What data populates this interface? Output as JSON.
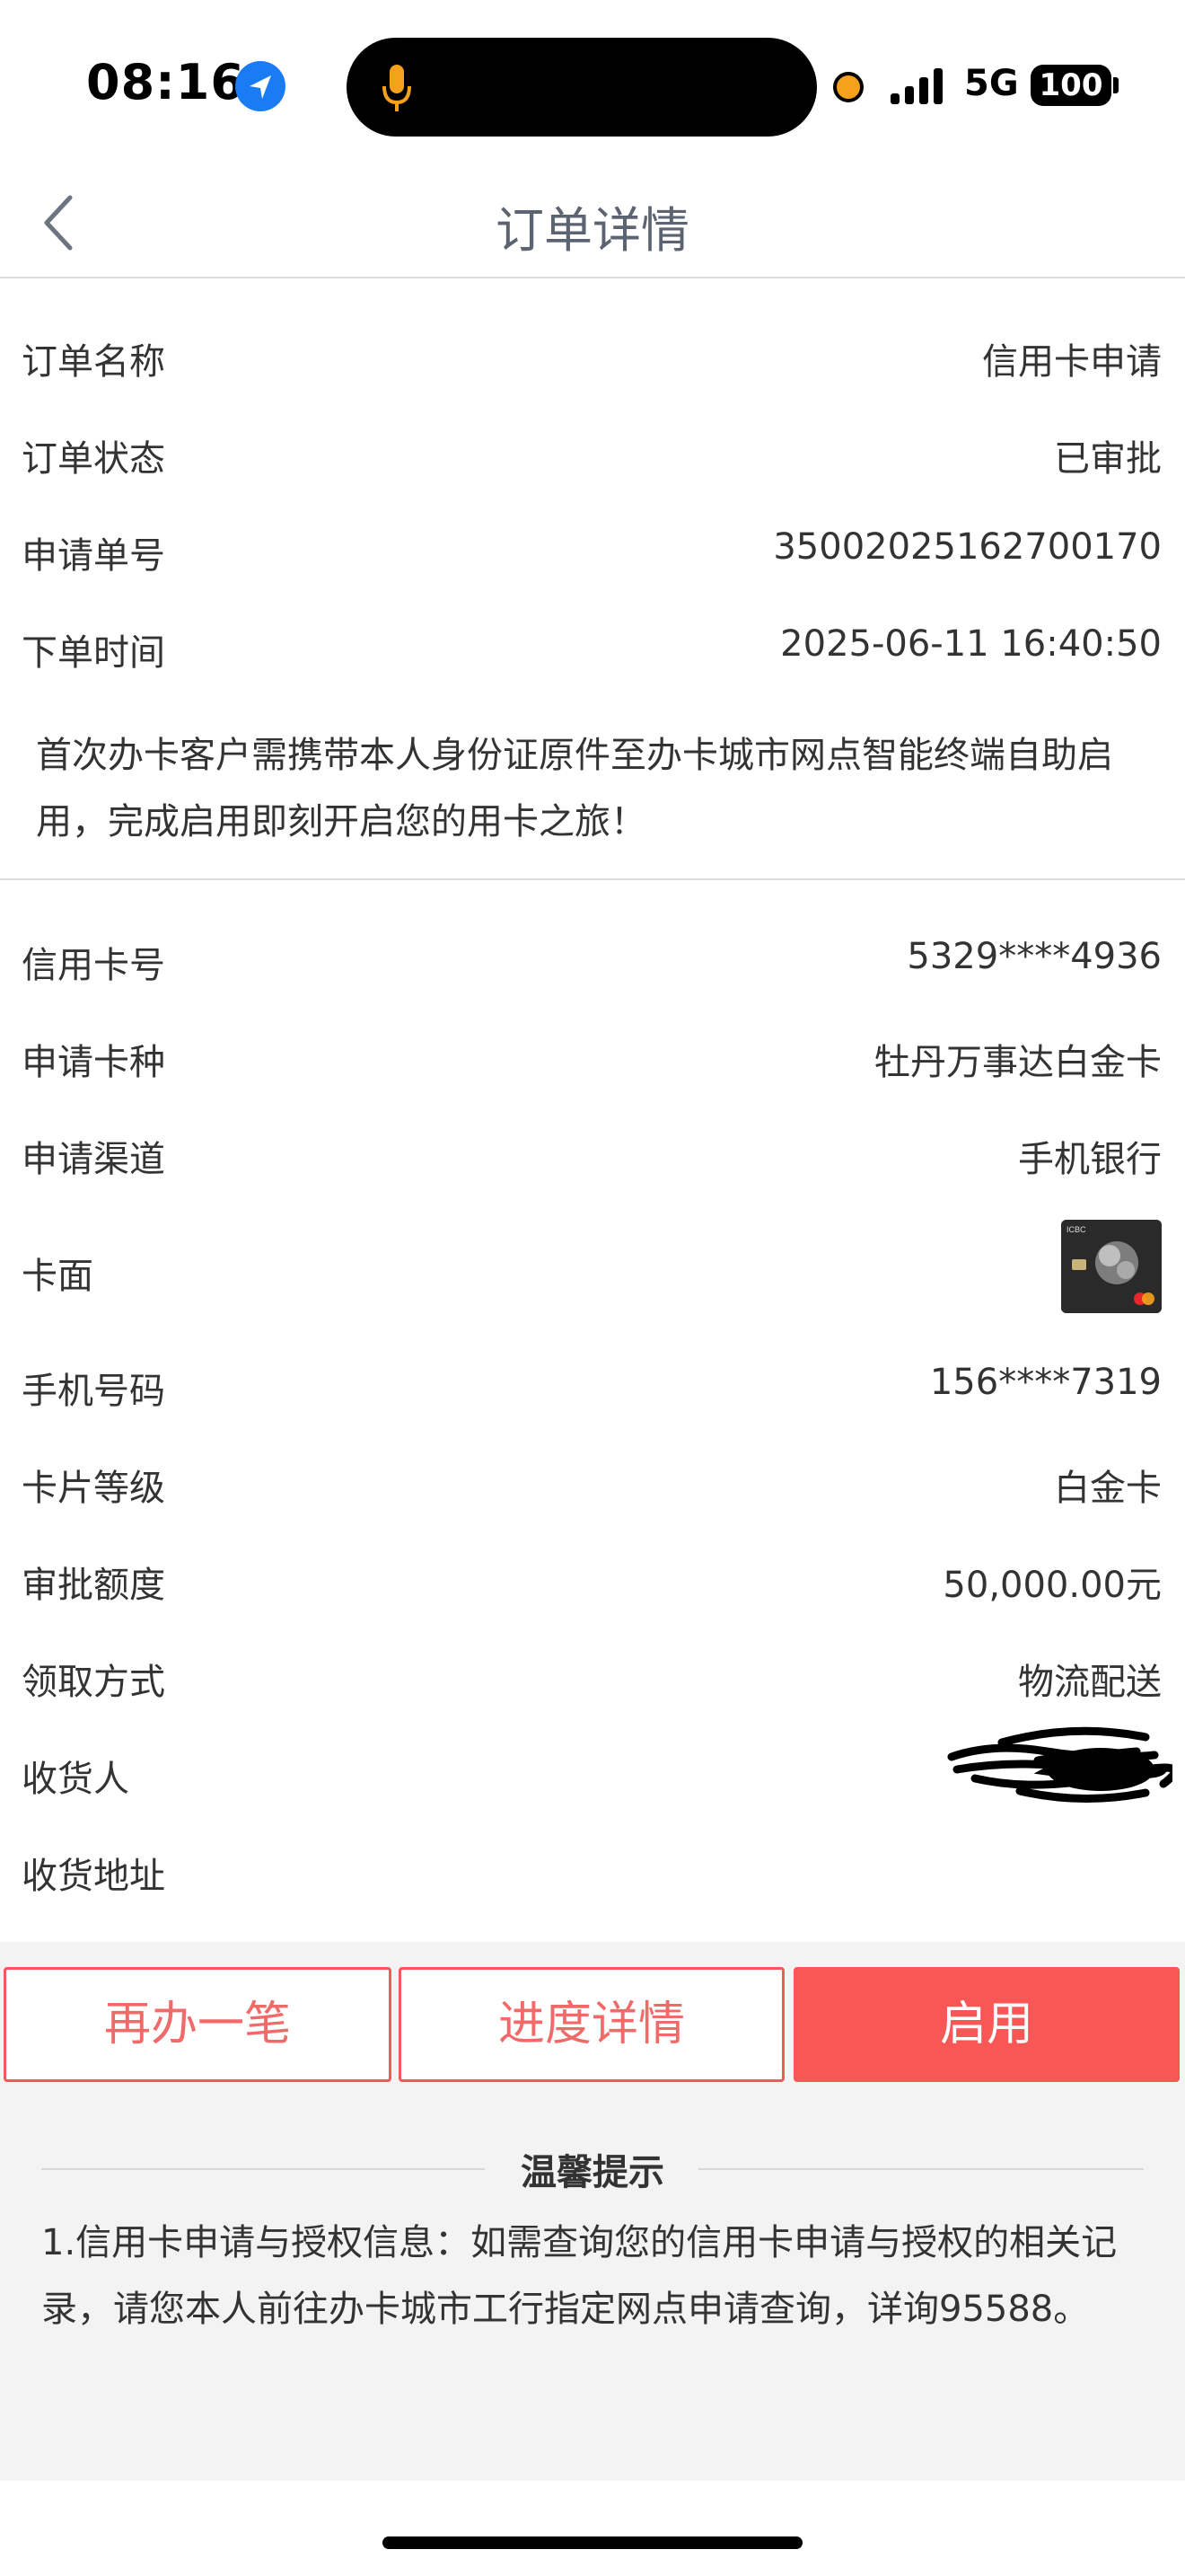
{
  "status_bar": {
    "time": "08:16",
    "network": "5G",
    "battery": "100"
  },
  "nav": {
    "title": "订单详情"
  },
  "order": {
    "rows": [
      {
        "label": "订单名称",
        "value": "信用卡申请"
      },
      {
        "label": "订单状态",
        "value": "已审批"
      },
      {
        "label": "申请单号",
        "value": "3500202516270017​0"
      },
      {
        "label": "下单时间",
        "value": "2025-06-11 16:40:50"
      }
    ],
    "notice": "首次办卡客户需携带本人身份证原件至办卡城市网点智能终端自助启用，完成启用即刻开启您的用卡之旅！"
  },
  "card": {
    "rows": [
      {
        "label": "信用卡号",
        "value": "5329****4936"
      },
      {
        "label": "申请卡种",
        "value": "牡丹万事达白金卡"
      },
      {
        "label": "申请渠道",
        "value": "手机银行"
      },
      {
        "label": "卡面",
        "value": ""
      },
      {
        "label": "手机号码",
        "value": "156****7319"
      },
      {
        "label": "卡片等级",
        "value": "白金卡"
      },
      {
        "label": "审批额度",
        "value": "50,000.00元"
      },
      {
        "label": "领取方式",
        "value": "物流配送"
      },
      {
        "label": "收货人",
        "value": ""
      },
      {
        "label": "收货地址",
        "value": ""
      }
    ],
    "card_face_brand": "ICBC"
  },
  "buttons": {
    "again": "再办一笔",
    "progress": "进度详情",
    "activate": "启用"
  },
  "tips": {
    "title": "温馨提示",
    "text": "1.信用卡申请与授权信息：如需查询您的信用卡申请与授权的相关记录，请您本人前往办卡城市工行指定网点申请查询，详询95588。"
  },
  "colors": {
    "accent": "#f95656",
    "nav_title": "#5b6470",
    "location": "#1a7cf5",
    "recording": "#f5a11c"
  }
}
